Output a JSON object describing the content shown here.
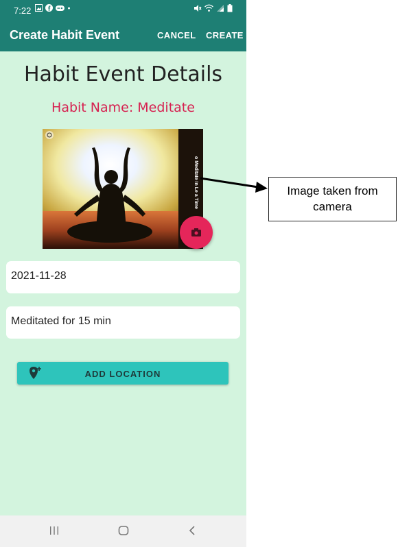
{
  "status_bar": {
    "time": "7:22"
  },
  "app_bar": {
    "title": "Create Habit Event",
    "cancel_label": "CANCEL",
    "create_label": "CREATE"
  },
  "content": {
    "heading": "Habit Event Details",
    "habit_name": "Habit Name: Meditate",
    "photo": {
      "overlay_text": "o Meditate In Le a Time"
    },
    "date_value": "2021-11-28",
    "comment_value": "Meditated for 15 min",
    "location_button_label": "ADD LOCATION"
  },
  "annotation": {
    "line1": "Image taken from",
    "line2": "camera"
  },
  "colors": {
    "primary": "#1e7f74",
    "background": "#d3f4de",
    "accent": "#e5265a",
    "button": "#2ec4bb"
  },
  "icons": [
    "image-icon",
    "facebook-icon",
    "game-icon",
    "mute-icon",
    "wifi-icon",
    "signal-icon",
    "battery-icon",
    "camera-icon",
    "add-location-icon",
    "recents-icon",
    "home-icon",
    "back-icon"
  ]
}
